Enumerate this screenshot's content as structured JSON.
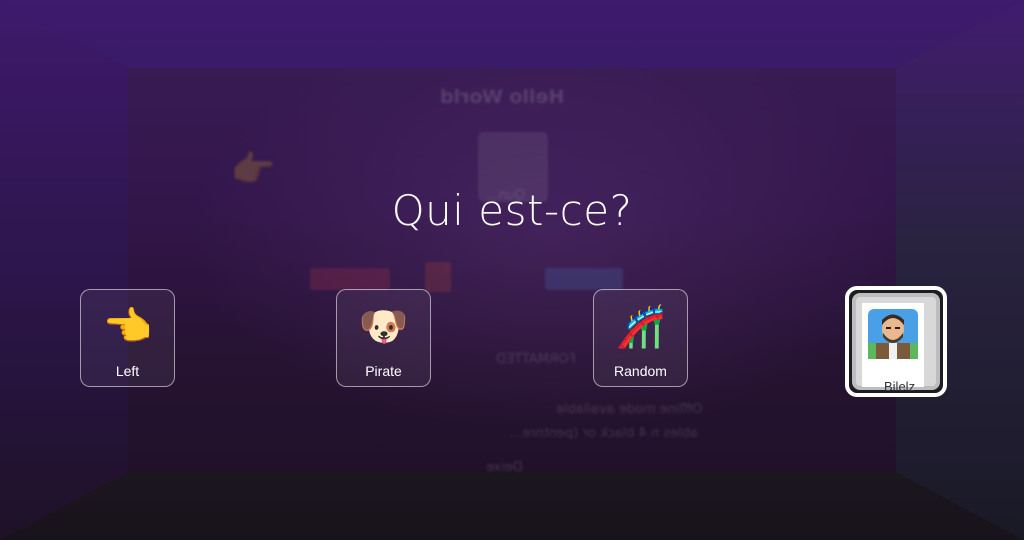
{
  "background_page": {
    "title": "Hello World",
    "name": "Qun...",
    "list_items": [
      "FORMATTED",
      "Offline mode available",
      "ables n 4 black or (pentnre..."
    ],
    "footer": "Deixe"
  },
  "prompt": {
    "text": "Qui est-ce?"
  },
  "choices": [
    {
      "label": "Left",
      "emoji": "👈"
    },
    {
      "label": "Pirate",
      "emoji": "🐶"
    },
    {
      "label": "Random",
      "emoji": "🎢"
    }
  ],
  "selected_choice": {
    "label": "Bilelz"
  },
  "colors": {
    "wall_top": "#4a1f7f",
    "text": "#ffffff",
    "selected_border": "#ffffff"
  }
}
